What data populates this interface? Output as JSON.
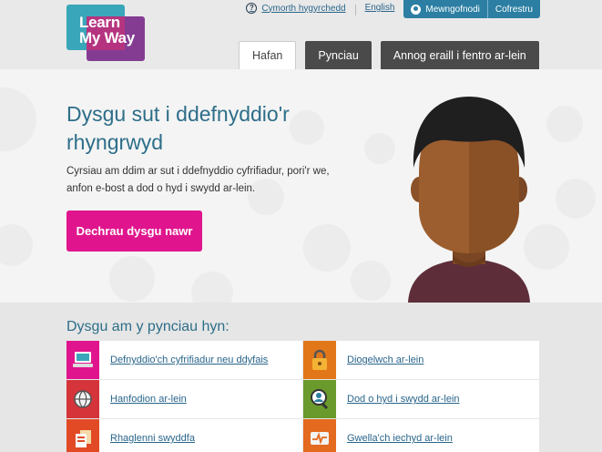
{
  "header": {
    "logo_line1": "Learn",
    "logo_line2": "My Way",
    "help_link": "Cymorth hygyrchedd",
    "language_link": "English",
    "signin_label": "Mewngofnodi",
    "register_label": "Cofrestru"
  },
  "tabs": [
    {
      "label": "Hafan",
      "active": true
    },
    {
      "label": "Pynciau",
      "active": false
    },
    {
      "label": "Annog eraill i fentro ar-lein",
      "active": false
    }
  ],
  "hero": {
    "title": "Dysgu sut i ddefnyddio'r rhyngrwyd",
    "description": "Cyrsiau am ddim ar sut i ddefnyddio cyfrifiadur, pori'r we, anfon e-bost a dod o hyd i swydd ar-lein.",
    "cta_label": "Dechrau dysgu nawr"
  },
  "topics": {
    "title": "Dysgu am y pynciau hyn:",
    "items": [
      {
        "label": "Defnyddio'ch cyfrifiadur neu ddyfais",
        "color": "#e0158d",
        "icon": "laptop-icon"
      },
      {
        "label": "Diogelwch ar-lein",
        "color": "#e2771a",
        "icon": "padlock-icon"
      },
      {
        "label": "Hanfodion ar-lein",
        "color": "#d4343a",
        "icon": "globe-icon"
      },
      {
        "label": "Dod o hyd i swydd ar-lein",
        "color": "#6a9a2c",
        "icon": "job-search-icon"
      },
      {
        "label": "Rhaglenni swyddfa",
        "color": "#e14a24",
        "icon": "office-documents-icon"
      },
      {
        "label": "Gwella'ch iechyd ar-lein",
        "color": "#e36a1e",
        "icon": "health-monitor-icon"
      }
    ]
  },
  "colors": {
    "brand_teal": "#3aa6b9",
    "brand_purple": "#7b2d8b",
    "cta_pink": "#e0158d",
    "title_blue": "#2d6e89",
    "link_blue": "#29658b"
  }
}
